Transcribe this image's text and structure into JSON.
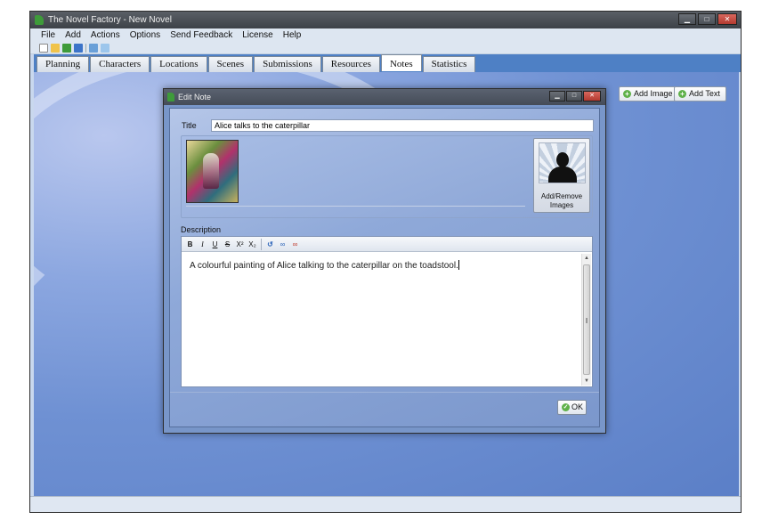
{
  "window": {
    "title": "The Novel Factory - New Novel"
  },
  "menu": [
    "File",
    "Add",
    "Actions",
    "Options",
    "Send Feedback",
    "License",
    "Help"
  ],
  "tabs": [
    "Planning",
    "Characters",
    "Locations",
    "Scenes",
    "Submissions",
    "Resources",
    "Notes",
    "Statistics"
  ],
  "active_tab": "Notes",
  "notes_toolbar": {
    "add_image": "Add Image",
    "add_text": "Add Text"
  },
  "dialog": {
    "title": "Edit Note",
    "title_label": "Title",
    "title_value": "Alice talks to the caterpillar",
    "add_remove_images": "Add/Remove Images",
    "description_label": "Description",
    "description_text": "A colourful painting of Alice talking to the caterpillar on the toadstool.",
    "format_buttons": [
      "B",
      "I",
      "U",
      "S",
      "X²",
      "X₂"
    ],
    "ok": "OK"
  },
  "colors": {
    "tabbar": "#4e80c5",
    "content_bg": "#6f91d3",
    "dialog_bg": "#7896c9"
  }
}
